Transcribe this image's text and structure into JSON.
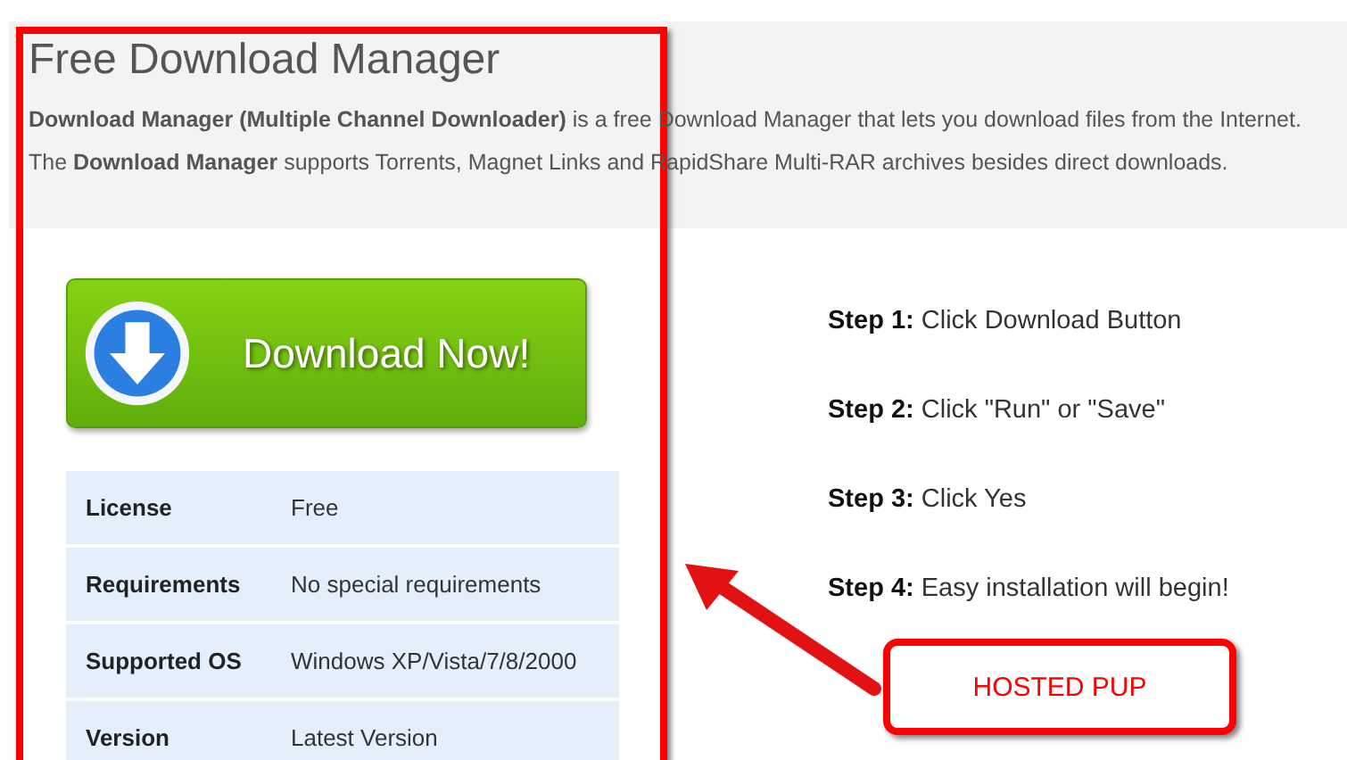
{
  "page": {
    "title": "Free Download Manager",
    "paragraphs": [
      "**Download Manager (Multiple Channel Downloader)** is a free Download Manager that lets you download files from the Internet.",
      "The **Download Manager** supports Torrents, Magnet Links and RapidShare Multi-RAR archives besides direct downloads."
    ]
  },
  "download_button": {
    "label": "Download Now!"
  },
  "details": [
    {
      "label": "License",
      "value": "Free"
    },
    {
      "label": "Requirements",
      "value": "No special requirements"
    },
    {
      "label": "Supported OS",
      "value": "Windows XP/Vista/7/8/2000"
    },
    {
      "label": "Version",
      "value": "Latest Version"
    }
  ],
  "steps": [
    "**Step 1:** Click Download Button",
    "**Step 2:** Click \"Run\" or \"Save\"",
    "**Step 3:** Click Yes",
    "**Step 4:** Easy installation will begin!"
  ],
  "annotation": {
    "callout": "HOSTED PUP"
  }
}
